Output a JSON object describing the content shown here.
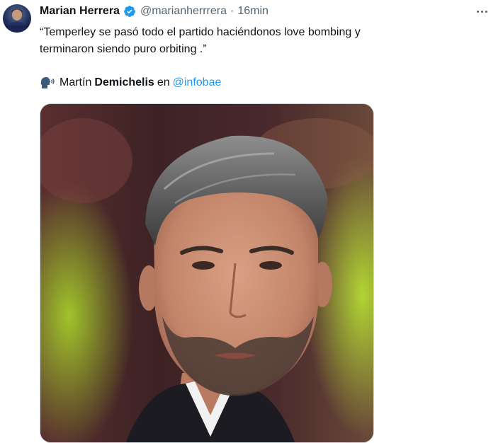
{
  "author": {
    "name": "Marian Herrera",
    "handle": "@marianherrrera",
    "separator": "·",
    "time": "16min",
    "verified": true
  },
  "tweet": {
    "line1": "“Temperley se pasó todo el partido haciéndonos love bombing y",
    "line2": "terminaron siendo puro orbiting .”"
  },
  "credit": {
    "icon": "speaking-head-icon",
    "first_name": "Martín",
    "last_name": "Demichelis",
    "connector": "en",
    "mention": "@infobae"
  },
  "media": {
    "kind": "photo"
  },
  "colors": {
    "text": "#0f1419",
    "secondary": "#536471",
    "link": "#1d9bf0",
    "verified": "#1d9bf0",
    "border": "#cfd9de"
  },
  "icons": {
    "verified": "verified-badge-icon",
    "more": "more-options-icon"
  }
}
